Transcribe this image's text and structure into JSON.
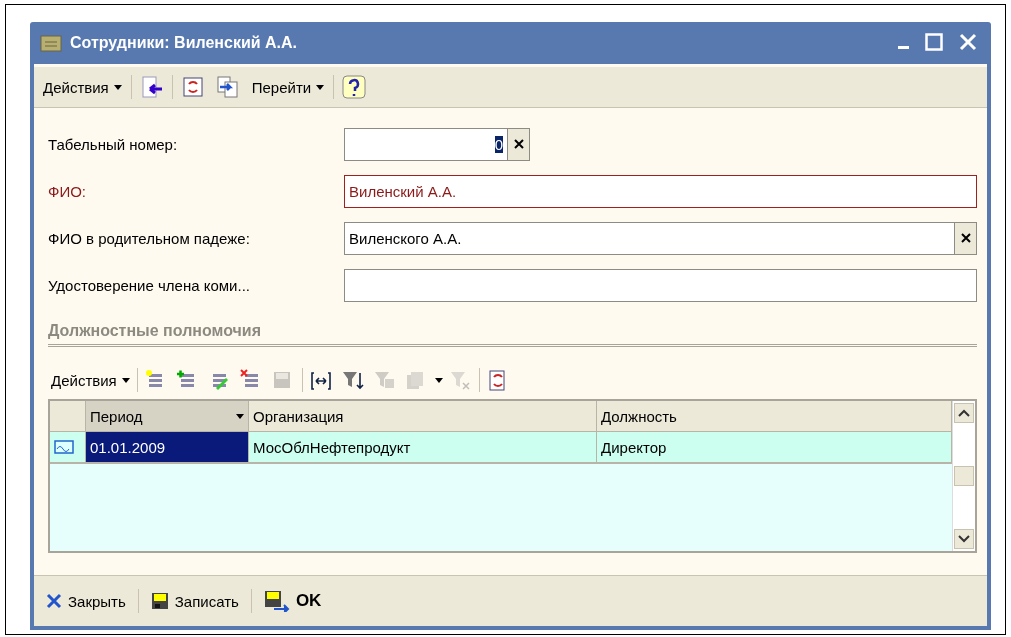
{
  "window": {
    "title": "Сотрудники: Виленский А.А."
  },
  "toolbar": {
    "actions_label": "Действия",
    "goto_label": "Перейти"
  },
  "fields": [
    {
      "label": "Табельный номер:",
      "value": "0",
      "required": false,
      "clearable": true,
      "kind": "short",
      "value_selected": true
    },
    {
      "label": "ФИО:",
      "value": "Виленский А.А.",
      "required": true,
      "kind": "wide",
      "value_selected": false
    },
    {
      "label": "ФИО в родительном падеже:",
      "value": "Виленского А.А.",
      "required": false,
      "clearable": true,
      "kind": "wide",
      "value_selected": false
    },
    {
      "label": "Удостоверение члена коми...",
      "required": false,
      "kind": "wide"
    }
  ],
  "section": {
    "title": "Должностные полномочия"
  },
  "table_toolbar": {
    "actions_label": "Действия",
    "buttons": [
      {
        "disabled": false
      },
      {
        "disabled": false
      },
      {
        "disabled": false
      },
      {
        "disabled": false
      },
      {
        "disabled": true
      },
      {
        "disabled": false
      },
      {
        "disabled": false
      },
      {
        "disabled": true
      },
      {
        "disabled": true
      },
      {
        "disabled": true
      },
      {
        "disabled": false
      }
    ]
  },
  "table": {
    "columns": [
      {
        "label": "Период",
        "sorted": true
      },
      {
        "label": "Организация",
        "sorted": false
      },
      {
        "label": "Должность",
        "sorted": false
      }
    ],
    "rows": [
      {
        "selected": true,
        "cells": [
          {
            "text": "01.01.2009",
            "selected": true
          },
          {
            "text": "МосОблНефтепродукт",
            "selected": false
          },
          {
            "text": "Директор",
            "selected": false
          }
        ]
      }
    ]
  },
  "footer": {
    "buttons": [
      {
        "label": "Закрыть",
        "kind": "close"
      },
      {
        "label": "Записать",
        "kind": "save"
      },
      {
        "label": "OK",
        "kind": "ok"
      }
    ]
  }
}
